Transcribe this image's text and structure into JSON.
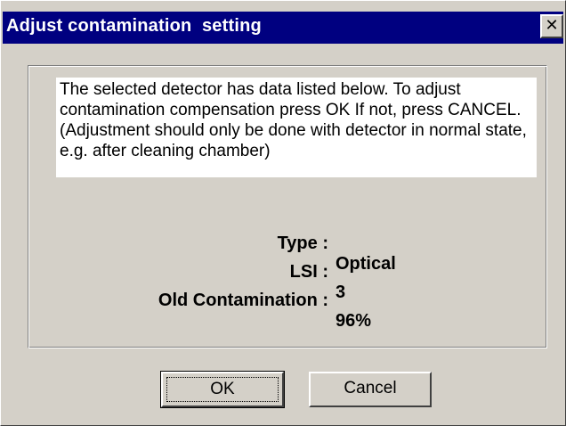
{
  "window": {
    "title": "Adjust contamination  setting",
    "close_glyph": "✕"
  },
  "message": {
    "text": "The selected detector has data listed below. To adjust contamination compensation press OK If not, press CANCEL. (Adjustment should only be done with detector in normal state, e.g. after cleaning chamber)"
  },
  "info": {
    "type_label": "Type :",
    "type_value": "Optical",
    "lsi_label": "LSI :",
    "lsi_value": "3",
    "contamination_label": "Old Contamination :",
    "contamination_value": "96%"
  },
  "buttons": {
    "ok_label": "OK",
    "cancel_label": "Cancel"
  },
  "colors": {
    "titlebar": "#000080",
    "face": "#d4d0c8"
  },
  "icons": {
    "close": "close-icon"
  }
}
